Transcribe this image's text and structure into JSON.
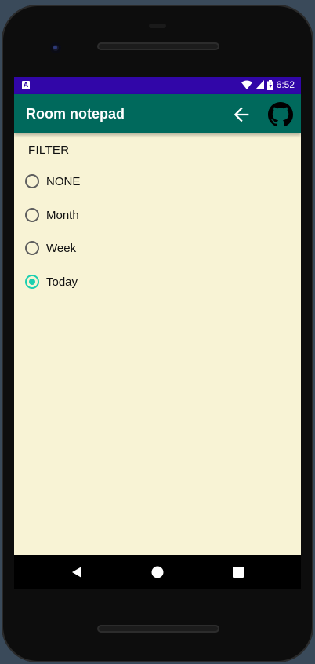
{
  "status_bar": {
    "time": "6:52",
    "notification_icon": "A",
    "icons": [
      "wifi-icon",
      "signal-icon",
      "battery-icon"
    ]
  },
  "app_bar": {
    "title": "Room notepad",
    "actions": [
      "back-arrow-icon",
      "github-icon"
    ]
  },
  "filter": {
    "heading": "FILTER",
    "options": [
      {
        "label": "NONE",
        "checked": false
      },
      {
        "label": "Month",
        "checked": false
      },
      {
        "label": "Week",
        "checked": false
      },
      {
        "label": "Today",
        "checked": true
      }
    ]
  },
  "nav_bar": {
    "buttons": [
      "back-triangle-icon",
      "home-circle-icon",
      "recents-square-icon"
    ]
  },
  "colors": {
    "status_bar": "#3106a8",
    "app_bar": "#00695c",
    "background": "#f8f3d5",
    "accent": "#1bd0b0"
  }
}
